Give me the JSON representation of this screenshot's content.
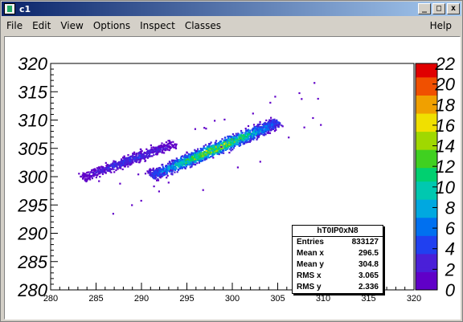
{
  "window": {
    "title": "c1",
    "minimize_label": "_",
    "maximize_label": "□",
    "close_label": "x"
  },
  "menu": {
    "file": "File",
    "edit": "Edit",
    "view": "View",
    "options": "Options",
    "inspect": "Inspect",
    "classes": "Classes",
    "help": "Help"
  },
  "stats_box": {
    "title": "hT0IP0xN8",
    "rows": [
      {
        "label": "Entries",
        "value": "833127"
      },
      {
        "label": "Mean x",
        "value": "296.5"
      },
      {
        "label": "Mean y",
        "value": "304.8"
      },
      {
        "label": "RMS x",
        "value": "3.065"
      },
      {
        "label": "RMS y",
        "value": "2.336"
      }
    ]
  },
  "chart_data": {
    "type": "heatmap",
    "title": "",
    "xlabel": "",
    "ylabel": "",
    "xlim": [
      280,
      320
    ],
    "ylim": [
      280,
      320
    ],
    "zlim": [
      0,
      22
    ],
    "x_ticks": [
      "280",
      "285",
      "290",
      "295",
      "300",
      "305",
      "310",
      "315",
      "320"
    ],
    "y_ticks": [
      "280",
      "285",
      "290",
      "295",
      "300",
      "305",
      "310",
      "315",
      "320"
    ],
    "z_ticks": [
      "0",
      "2",
      "4",
      "6",
      "8",
      "10",
      "12",
      "14",
      "16",
      "18",
      "20",
      "22"
    ],
    "bands": [
      {
        "name": "",
        "center_x": 298,
        "center_y": 305,
        "slope": 0.68,
        "length": 17,
        "width": 1.4,
        "peak": 15
      },
      {
        "name": "",
        "center_x": 288.5,
        "center_y": 303,
        "slope": 0.6,
        "length": 12,
        "width": 1.2,
        "peak": 4
      }
    ],
    "colors": [
      "#6000c8",
      "#4a1fd8",
      "#2040f0",
      "#0070f0",
      "#00a8e0",
      "#00c8b0",
      "#00d070",
      "#40d020",
      "#a0d800",
      "#f0e000",
      "#f0a000",
      "#f05000",
      "#e00000"
    ],
    "frame_color": "#000000",
    "background": "#ffffff"
  }
}
